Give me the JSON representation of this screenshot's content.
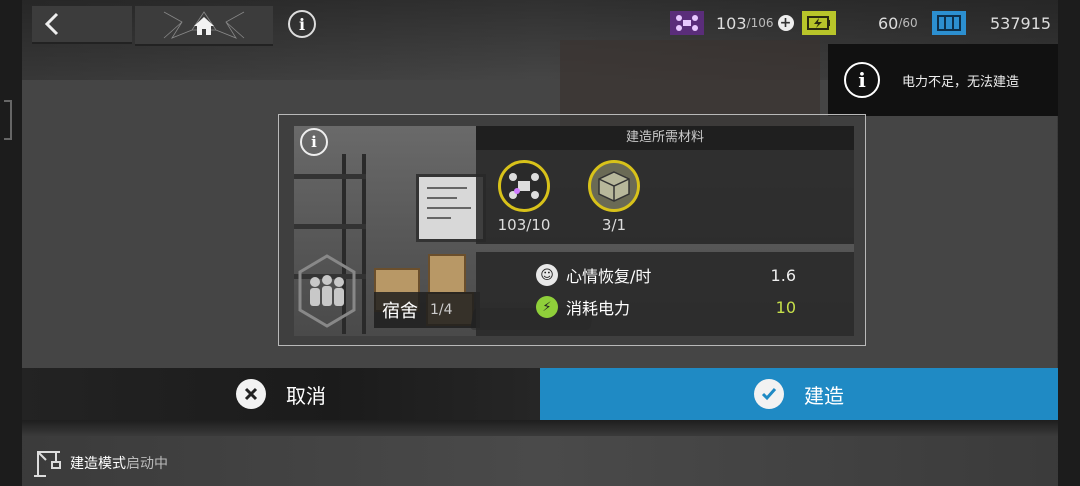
{
  "top_bar": {
    "back_icon": "chevron-left-icon",
    "home_icon": "home-icon",
    "info_icon": "info-icon"
  },
  "resources": {
    "drone_current": "103",
    "drone_max": "/106",
    "power_current": "60",
    "power_max": "/60",
    "materials_total": "537915"
  },
  "notice": {
    "message": "电力不足，无法建造"
  },
  "panel": {
    "materials_title": "建造所需材料",
    "materials": [
      {
        "icon": "drone-icon",
        "count": "103/10"
      },
      {
        "icon": "crate-icon",
        "count": "3/1"
      }
    ],
    "room_name": "宿舍",
    "room_level": "1/4",
    "stats": [
      {
        "icon": "mood-icon",
        "label": "心情恢复/时",
        "value": "1.6"
      },
      {
        "icon": "power-icon",
        "label": "消耗电力",
        "value": "10"
      }
    ]
  },
  "buttons": {
    "cancel": "取消",
    "build": "建造"
  },
  "status": {
    "mode_prefix": "建造模式",
    "mode_suffix": "启动中"
  },
  "colors": {
    "accent_blue": "#1f8ac4",
    "gold": "#d8c21a",
    "stat_green": "#c6e04a",
    "drone_purple": "#5a2d7a",
    "battery_green": "#b8c52a"
  }
}
